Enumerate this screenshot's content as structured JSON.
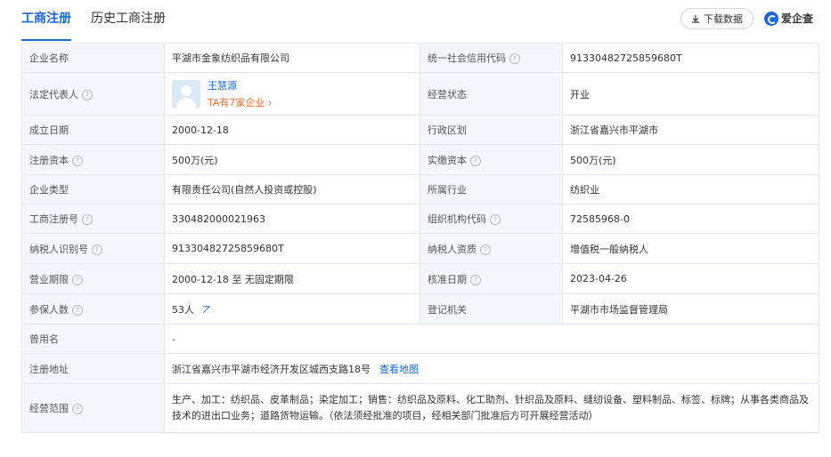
{
  "tabs": [
    "工商注册",
    "历史工商注册"
  ],
  "download_label": "下载数据",
  "brand": "爱企查",
  "rows": {
    "company_name": {
      "label": "企业名称",
      "value": "平湖市金象纺织品有限公司"
    },
    "credit_code": {
      "label": "统一社会信用代码",
      "value": "91330482725859680T"
    },
    "legal_rep": {
      "label": "法定代表人",
      "name": "王慧源",
      "more": "TA有7家企业"
    },
    "status": {
      "label": "经营状态",
      "value": "开业"
    },
    "found_date": {
      "label": "成立日期",
      "value": "2000-12-18"
    },
    "region": {
      "label": "行政区划",
      "value": "浙江省嘉兴市平湖市"
    },
    "reg_capital": {
      "label": "注册资本",
      "value": "500万(元)"
    },
    "paid_capital": {
      "label": "实缴资本",
      "value": "500万(元)"
    },
    "ent_type": {
      "label": "企业类型",
      "value": "有限责任公司(自然人投资或控股)"
    },
    "industry": {
      "label": "所属行业",
      "value": "纺织业"
    },
    "reg_no": {
      "label": "工商注册号",
      "value": "330482000021963"
    },
    "org_code": {
      "label": "组织机构代码",
      "value": "72585968-0"
    },
    "taxpayer_id": {
      "label": "纳税人识别号",
      "value": "91330482725859680T"
    },
    "taxpayer_qual": {
      "label": "纳税人资质",
      "value": "增值税一般纳税人"
    },
    "biz_term": {
      "label": "营业期限",
      "value": "2000-12-18 至 无固定期限"
    },
    "approval_date": {
      "label": "核准日期",
      "value": "2023-04-26"
    },
    "insured": {
      "label": "参保人数",
      "value": "53人"
    },
    "authority": {
      "label": "登记机关",
      "value": "平湖市市场监督管理局"
    },
    "former_name": {
      "label": "曾用名",
      "value": "-"
    },
    "address": {
      "label": "注册地址",
      "value": "浙江省嘉兴市平湖市经济开发区城西支路18号",
      "link": "查看地图"
    },
    "scope": {
      "label": "经营范围",
      "value": "生产、加工：纺织品、皮革制品；染定加工；销售：纺织品及原料、化工助剂、针织品及原料、缝纫设备、塑料制品、标签、标牌；从事各类商品及技术的进出口业务；道路货物运输。（依法须经批准的项目，经相关部门批准后方可开展经营活动）"
    }
  }
}
